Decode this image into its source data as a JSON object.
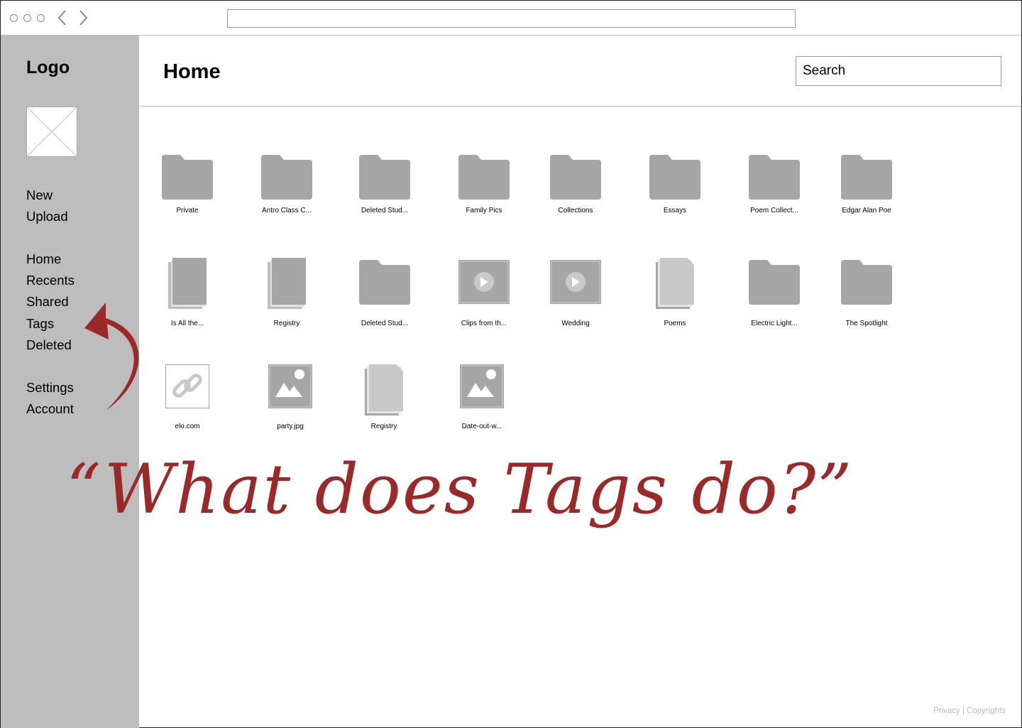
{
  "sidebar": {
    "logo": "Logo",
    "actions": [
      "New",
      "Upload"
    ],
    "nav": [
      "Home",
      "Recents",
      "Shared",
      "Tags",
      "Deleted"
    ],
    "account": [
      "Settings",
      "Account"
    ]
  },
  "header": {
    "title": "Home",
    "search_placeholder": "Search"
  },
  "files": [
    {
      "type": "folder",
      "name": "Private"
    },
    {
      "type": "folder",
      "name": "Antro Class C..."
    },
    {
      "type": "folder",
      "name": "Deleted Stud..."
    },
    {
      "type": "folder",
      "name": "Family Pics"
    },
    {
      "type": "folder",
      "name": "Collections"
    },
    {
      "type": "folder",
      "name": "Essays"
    },
    {
      "type": "folder",
      "name": "Poem Collect..."
    },
    {
      "type": "folder",
      "name": "Edgar Alan Poe"
    },
    {
      "type": "document-stack",
      "name": "Is All the..."
    },
    {
      "type": "document-stack",
      "name": "Registry"
    },
    {
      "type": "folder",
      "name": "Deleted Stud..."
    },
    {
      "type": "video",
      "name": "Clips from th..."
    },
    {
      "type": "video",
      "name": "Wedding"
    },
    {
      "type": "document-light",
      "name": "Poems"
    },
    {
      "type": "folder",
      "name": "Electric Light..."
    },
    {
      "type": "folder",
      "name": "The Spotlight"
    },
    {
      "type": "link",
      "name": "elo.com"
    },
    {
      "type": "image",
      "name": "party.jpg"
    },
    {
      "type": "document-light",
      "name": "Registry"
    },
    {
      "type": "image",
      "name": "Date-out-w..."
    }
  ],
  "annotation": "“What does Tags do?”",
  "annotation_color": "#9a2a2a",
  "footer": "Privacy | Copyrights"
}
